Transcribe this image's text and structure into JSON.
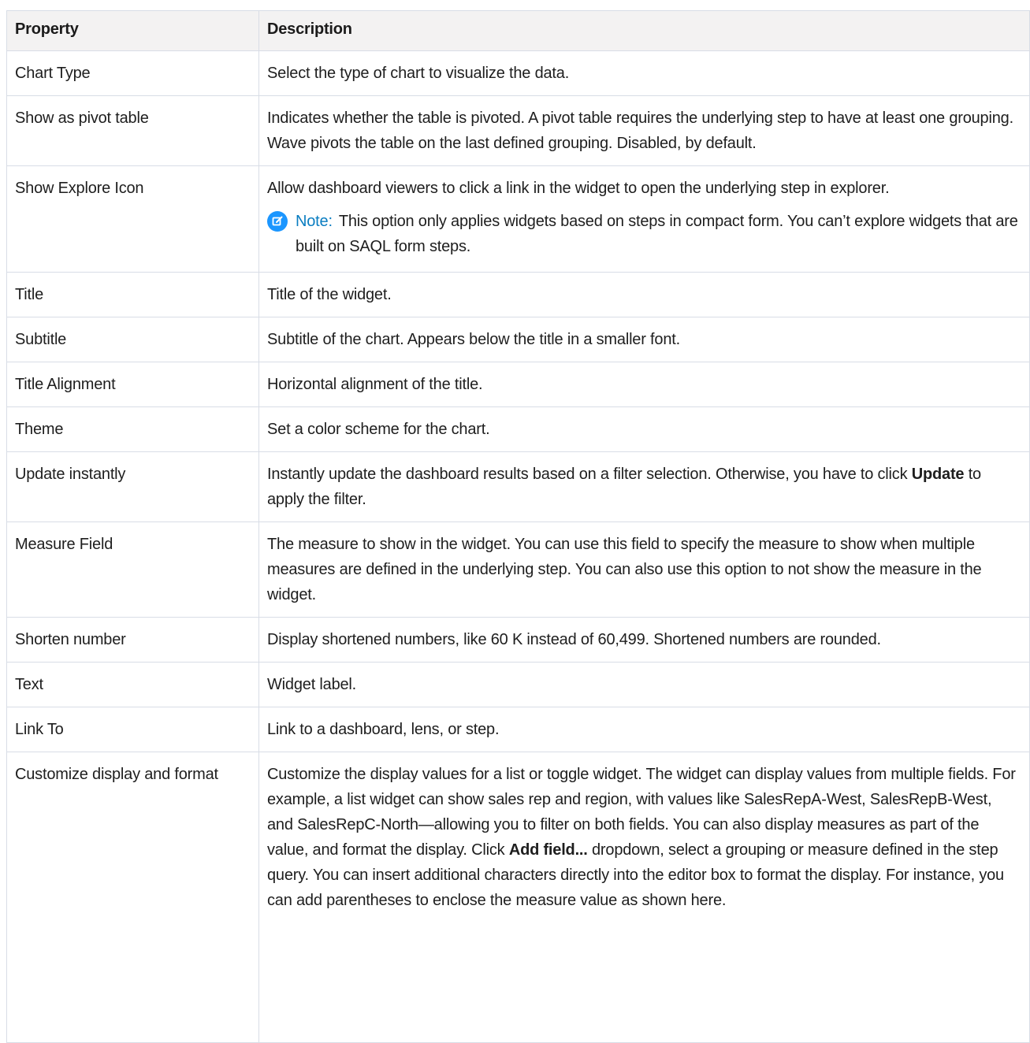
{
  "table": {
    "headers": {
      "property": "Property",
      "description": "Description"
    },
    "rows": [
      {
        "property": "Chart Type",
        "description": "Select the type of chart to visualize the data."
      },
      {
        "property": "Show as pivot table",
        "description": "Indicates whether the table is pivoted. A pivot table requires the underlying step to have at least one grouping. Wave pivots the table on the last defined grouping. Disabled, by default."
      },
      {
        "property": "Show Explore Icon",
        "description": "Allow dashboard viewers to click a link in the widget to open the underlying step in explorer.",
        "note": {
          "label": "Note:",
          "text": "This option only applies widgets based on steps in compact form. You can’t explore widgets that are built on SAQL form steps.",
          "icon": "edit-note-icon",
          "icon_color": "#1b96ff",
          "label_color": "#0a7dc1"
        }
      },
      {
        "property": "Title",
        "description": "Title of the widget."
      },
      {
        "property": "Subtitle",
        "description": "Subtitle of the chart. Appears below the title in a smaller font."
      },
      {
        "property": "Title Alignment",
        "description": "Horizontal alignment of the title."
      },
      {
        "property": "Theme",
        "description": "Set a color scheme for the chart."
      },
      {
        "property": "Update instantly",
        "description_before": "Instantly update the dashboard results based on a filter selection. Otherwise, you have to click ",
        "description_bold": "Update",
        "description_after": " to apply the filter."
      },
      {
        "property": "Measure Field",
        "description": "The measure to show in the widget. You can use this field to specify the measure to show when multiple measures are defined in the underlying step. You can also use this option to not show the measure in the widget."
      },
      {
        "property": "Shorten number",
        "description": "Display shortened numbers, like 60 K instead of 60,499. Shortened numbers are rounded."
      },
      {
        "property": "Text",
        "description": "Widget label."
      },
      {
        "property": "Link To",
        "description": "Link to a dashboard, lens, or step."
      },
      {
        "property": "Customize display and format",
        "description_before": "Customize the display values for a list or toggle widget. The widget can display values from multiple fields. For example, a list widget can show sales rep and region, with values like SalesRepA-West, SalesRepB-West, and SalesRepC-North—allowing you to filter on both fields. You can also display measures as part of the value, and format the display. Click ",
        "description_bold": "Add field...",
        "description_after": " dropdown, select a grouping or measure defined in the step query. You can insert additional characters directly into the editor box to format the display. For instance, you can add parentheses to enclose the measure value as shown here."
      }
    ]
  },
  "colors": {
    "header_bg": "#f3f2f2",
    "border": "#d8dde6",
    "text": "#1e1e1e"
  }
}
